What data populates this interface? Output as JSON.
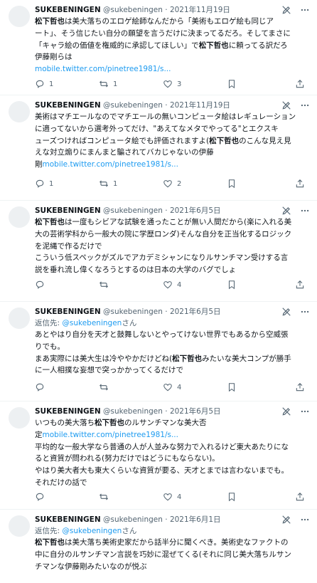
{
  "tweets": [
    {
      "name": "SUKEBENINGEN",
      "handle": "@sukebeningen",
      "date": "· 2021年11月19日",
      "reply_label": "",
      "reply_handle": "",
      "reply_suffix": "",
      "lines": [
        [
          {
            "t": "松下哲也",
            "b": true
          },
          {
            "t": "は美大落ちのエロゲ絵師なんだから「美術もエロゲ絵も同じア"
          }
        ],
        [
          {
            "t": "ート」、そう信じたい自分の願望を言うだけに決まってるだろ。そしてまさに"
          }
        ],
        [
          {
            "t": "「キャラ絵の価値を権威的に承認してほしい」で"
          },
          {
            "t": "松下哲也",
            "b": true
          },
          {
            "t": "に頼ってる訳だろ"
          }
        ],
        [
          {
            "t": "伊藤剛らは"
          }
        ],
        [
          {
            "t": "mobile.twitter.com/pinetree1981/s...",
            "l": true
          }
        ]
      ],
      "counts": {
        "reply": "1",
        "retweet": "1",
        "like": "3"
      }
    },
    {
      "name": "SUKEBENINGEN",
      "handle": "@sukebeningen",
      "date": "· 2021年11月19日",
      "reply_label": "",
      "reply_handle": "",
      "reply_suffix": "",
      "lines": [
        [
          {
            "t": "美術はマチエールなのでマチエールの無いコンピュータ絵はレギュレーション"
          }
        ],
        [
          {
            "t": "に適ってないから選考外ってだけ、\"あえてなメタでやってる\"とエクスキ"
          }
        ],
        [
          {
            "t": "ューズつければコンピュータ絵でも評価されますよ("
          },
          {
            "t": "松下哲也",
            "b": true
          },
          {
            "t": "のこんな見え見"
          }
        ],
        [
          {
            "t": "えな対立煽りにまんまと騙されてバカじゃないの伊藤"
          }
        ],
        [
          {
            "t": "剛"
          },
          {
            "t": "mobile.twitter.com/pinetree1981/s...",
            "l": true
          }
        ]
      ],
      "counts": {
        "reply": "1",
        "retweet": "1",
        "like": "2"
      }
    },
    {
      "name": "SUKEBENINGEN",
      "handle": "@sukebeningen",
      "date": "· 2021年6月5日",
      "reply_label": "",
      "reply_handle": "",
      "reply_suffix": "",
      "lines": [
        [
          {
            "t": "松下哲也",
            "b": true
          },
          {
            "t": "は一度もシビアな試験を通ったことが無い人間だから(楽に入れる美"
          }
        ],
        [
          {
            "t": "大の芸術学科から一般大の院に学歴ロンダ)そんな自分を正当化するロジック"
          }
        ],
        [
          {
            "t": "を泥縄で作るだけで"
          }
        ],
        [
          {
            "t": "こういう低スペックがズルでアカデミシャンになりルサンチマン受けする言"
          }
        ],
        [
          {
            "t": "説を垂れ流し偉くなろうとするのは日本の大学のバグでしょ"
          }
        ]
      ],
      "counts": {
        "reply": "",
        "retweet": "",
        "like": "4"
      }
    },
    {
      "name": "SUKEBENINGEN",
      "handle": "@sukebeningen",
      "date": "· 2021年6月5日",
      "reply_label": "返信先: ",
      "reply_handle": "@sukebeningen",
      "reply_suffix": "さん",
      "lines": [
        [
          {
            "t": "あとやはり自分を天才と鼓舞しないとやってけない世界でもあるから空威張"
          }
        ],
        [
          {
            "t": "りでも。"
          }
        ],
        [
          {
            "t": "まあ実際には美大生は冷ややかだけどね("
          },
          {
            "t": "松下哲也",
            "b": true
          },
          {
            "t": "みたいな美大コンプが勝手"
          }
        ],
        [
          {
            "t": "に一人相撲な妄想で突っかかってくるだけで"
          }
        ]
      ],
      "counts": {
        "reply": "",
        "retweet": "",
        "like": "4"
      }
    },
    {
      "name": "SUKEBENINGEN",
      "handle": "@sukebeningen",
      "date": "· 2021年6月5日",
      "reply_label": "",
      "reply_handle": "",
      "reply_suffix": "",
      "lines": [
        [
          {
            "t": "いつもの美大落ち"
          },
          {
            "t": "松下哲也",
            "b": true
          },
          {
            "t": "のルサンチマンな美大否"
          }
        ],
        [
          {
            "t": "定"
          },
          {
            "t": "mobile.twitter.com/pinetree1981/s...",
            "l": true
          }
        ],
        [
          {
            "t": "平均的な一般大学なら普通の人が人並みな努力で入れるけど東大あたりにな"
          }
        ],
        [
          {
            "t": "ると資質が問われる(努力だけではどうにもならない)。"
          }
        ],
        [
          {
            "t": "やはり美大者大も東大くらいな資質が要る、天才とまでは言わないまでも。"
          }
        ],
        [
          {
            "t": "それだけの話で"
          }
        ]
      ],
      "counts": {
        "reply": "",
        "retweet": "",
        "like": "4"
      }
    },
    {
      "name": "SUKEBENINGEN",
      "handle": "@sukebeningen",
      "date": "· 2021年6月1日",
      "reply_label": "返信先: ",
      "reply_handle": "@sukebeningen",
      "reply_suffix": "さん",
      "lines": [
        [
          {
            "t": "松下哲也",
            "b": true
          },
          {
            "t": "は美大落ち美術史家だから話半分に聞くべき。美術史なファクトの"
          }
        ],
        [
          {
            "t": "中に自分のルサンチマン言説を巧妙に混ぜてくる(それに同じ美大落ちルサン"
          }
        ],
        [
          {
            "t": "チマンな伊藤剛みたいなのが悦ぶ"
          }
        ]
      ],
      "counts": {
        "reply": "",
        "retweet": "",
        "like": ""
      }
    }
  ]
}
